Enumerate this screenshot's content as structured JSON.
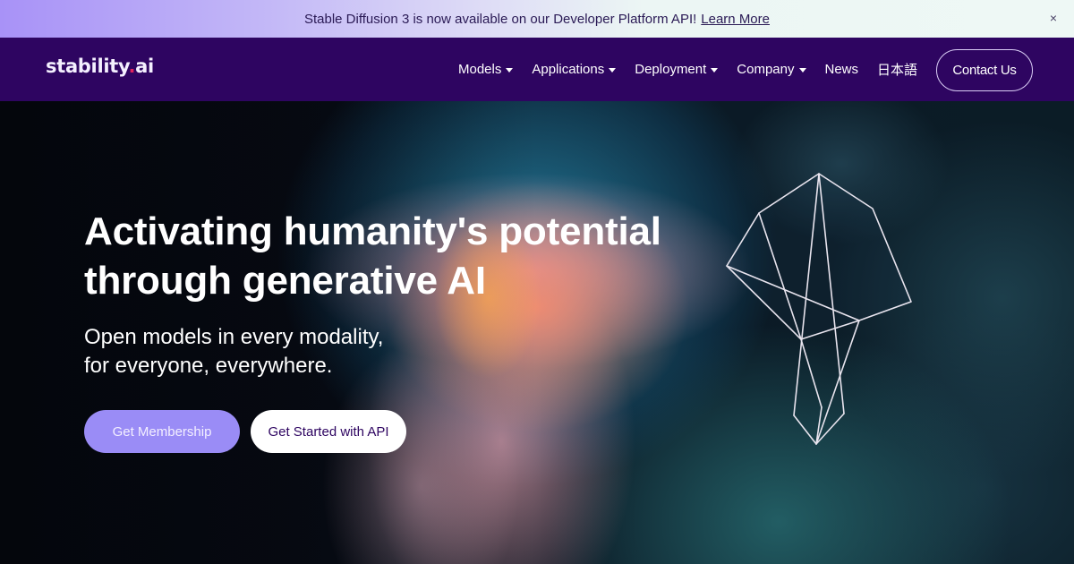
{
  "banner": {
    "message": "Stable Diffusion 3 is now available on our Developer Platform API!",
    "link_label": "Learn More",
    "close_icon": "×"
  },
  "nav": {
    "logo": {
      "text_main": "stability",
      "dot": ".",
      "text_end": "ai"
    },
    "items": [
      {
        "label": "Models",
        "dropdown": true
      },
      {
        "label": "Applications",
        "dropdown": true
      },
      {
        "label": "Deployment",
        "dropdown": true
      },
      {
        "label": "Company",
        "dropdown": true
      },
      {
        "label": "News",
        "dropdown": false
      },
      {
        "label": "日本語",
        "dropdown": false
      }
    ],
    "contact_label": "Contact Us"
  },
  "hero": {
    "headline_line1": "Activating humanity's potential",
    "headline_line2": "through generative AI",
    "sub_line1": "Open models in every modality,",
    "sub_line2": "for everyone, everywhere.",
    "primary_button": "Get Membership",
    "secondary_button": "Get Started with API"
  },
  "colors": {
    "nav_bg": "#2e0561",
    "logo_dot": "#e0245e",
    "primary_button": "#9a8cf6",
    "secondary_button_text": "#2e0561",
    "banner_text": "#2a1a55"
  }
}
